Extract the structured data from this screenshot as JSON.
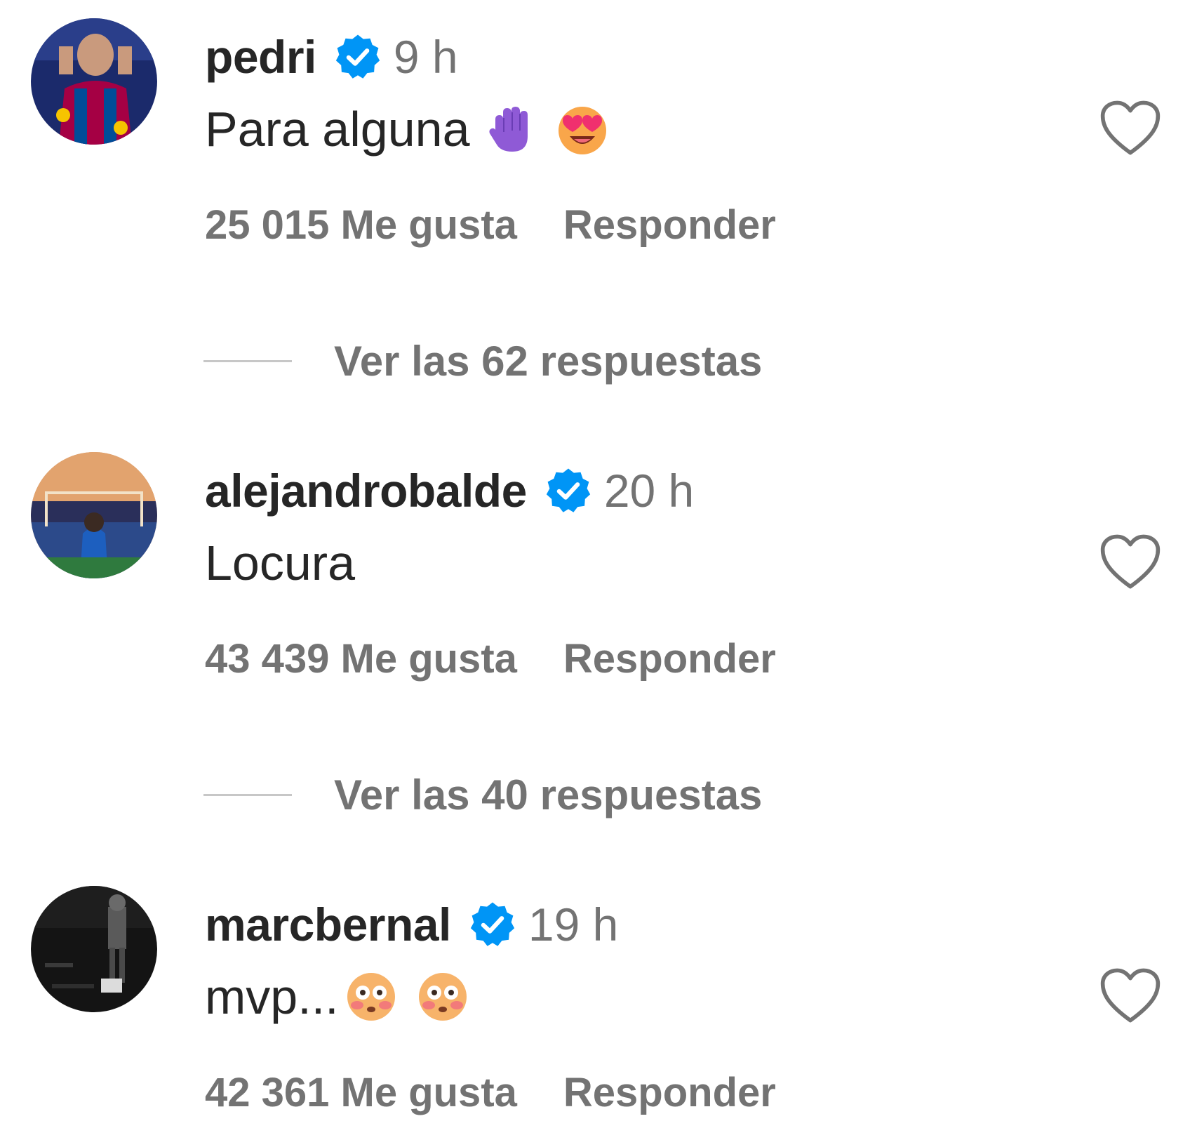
{
  "comments": [
    {
      "username": "pedri",
      "time": "9 h",
      "text": "Para alguna",
      "emojis": [
        "raised-hand-purple-emoji",
        "heart-eyes-emoji"
      ],
      "likes": "25 015 Me gusta",
      "reply_label": "Responder",
      "view_replies": "Ver las 62 respuestas"
    },
    {
      "username": "alejandrobalde",
      "time": "20 h",
      "text": "Locura",
      "emojis": [],
      "likes": "43 439 Me gusta",
      "reply_label": "Responder",
      "view_replies": "Ver las 40 respuestas"
    },
    {
      "username": "marcbernal",
      "time": "19 h",
      "text": "mvp...",
      "emojis": [
        "flushed-face-emoji",
        "flushed-face-emoji"
      ],
      "likes": "42 361 Me gusta",
      "reply_label": "Responder"
    }
  ],
  "colors": {
    "text": "#262626",
    "secondary": "#737373",
    "verified": "#0095f6",
    "divider": "#c7c7c7"
  }
}
